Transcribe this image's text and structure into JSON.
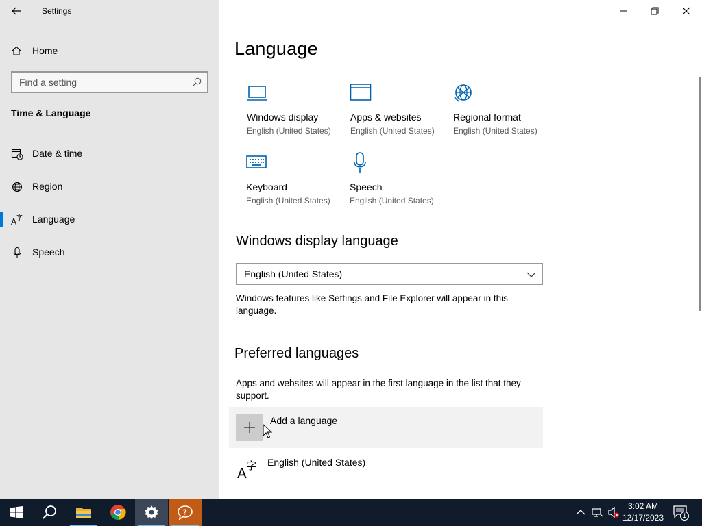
{
  "window": {
    "title": "Settings",
    "minimize_icon": "minimize-icon",
    "restore_icon": "restore-icon",
    "close_icon": "close-icon"
  },
  "sidebar": {
    "home_label": "Home",
    "search_placeholder": "Find a setting",
    "section_title": "Time & Language",
    "items": [
      {
        "label": "Date & time",
        "icon": "calendar-clock-icon"
      },
      {
        "label": "Region",
        "icon": "globe-icon"
      },
      {
        "label": "Language",
        "icon": "language-icon",
        "active": true
      },
      {
        "label": "Speech",
        "icon": "microphone-icon"
      }
    ]
  },
  "main": {
    "title": "Language",
    "tiles": [
      {
        "name": "Windows display",
        "sub": "English (United States)",
        "icon": "monitor-icon"
      },
      {
        "name": "Apps & websites",
        "sub": "English (United States)",
        "icon": "browser-window-icon"
      },
      {
        "name": "Regional format",
        "sub": "English (United States)",
        "icon": "globe-icon"
      },
      {
        "name": "Keyboard",
        "sub": "English (United States)",
        "icon": "keyboard-icon"
      },
      {
        "name": "Speech",
        "sub": "English (United States)",
        "icon": "microphone-icon"
      }
    ],
    "display_language": {
      "heading": "Windows display language",
      "selected": "English (United States)",
      "description": "Windows features like Settings and File Explorer will appear in this language."
    },
    "preferred": {
      "heading": "Preferred languages",
      "description": "Apps and websites will appear in the first language in the list that they support.",
      "add_label": "Add a language",
      "languages": [
        "English (United States)"
      ]
    }
  },
  "taskbar": {
    "apps": [
      "start-icon",
      "search-icon",
      "file-explorer-icon",
      "chrome-icon",
      "settings-icon",
      "get-help-icon"
    ],
    "active_app": "settings-icon",
    "clock_time": "3:02 AM",
    "clock_date": "12/17/2023",
    "notification_count": "1",
    "colors": {
      "accent": "#0078d7",
      "taskbar": "#101c2b"
    }
  }
}
